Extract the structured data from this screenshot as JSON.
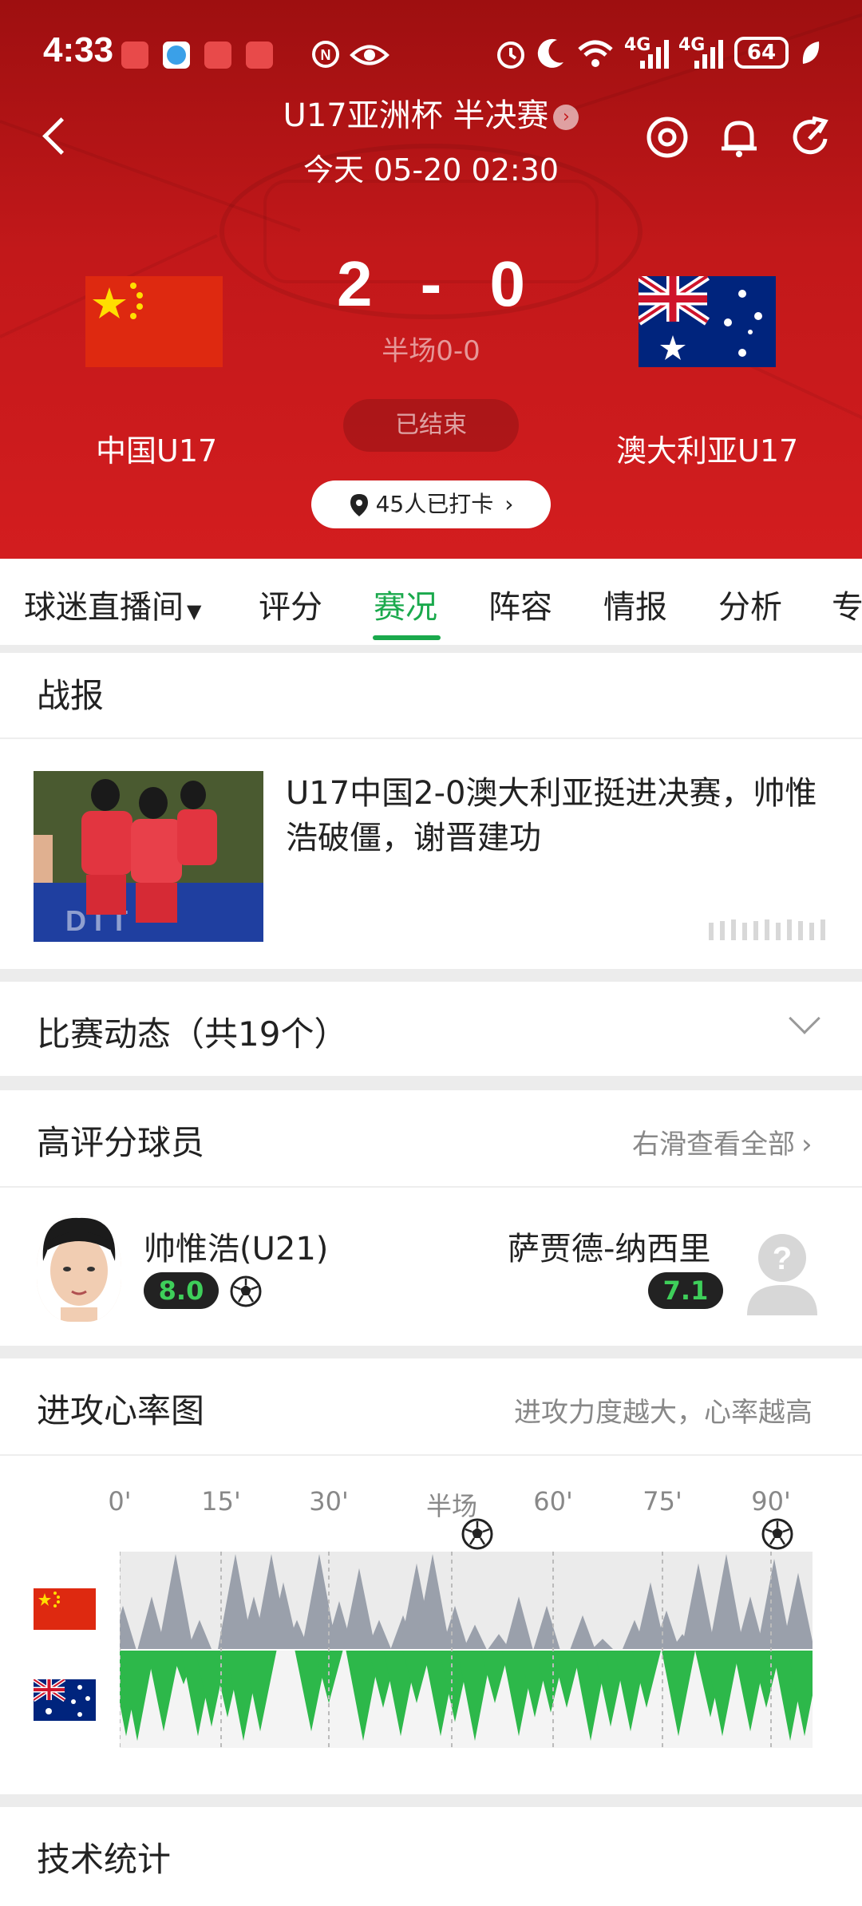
{
  "status_bar": {
    "time": "4:33",
    "battery": "64",
    "net1": "4G",
    "net2": "4G"
  },
  "header": {
    "competition": "U17亚洲杯 半决赛",
    "match_time": "今天 05-20 02:30",
    "home_team": "中国U17",
    "away_team": "澳大利亚U17",
    "home_score": "2",
    "score_sep": "-",
    "away_score": "0",
    "halftime": "半场0-0",
    "status": "已结束",
    "checkin": "45人已打卡"
  },
  "tabs": [
    "球迷直播间",
    "评分",
    "赛况",
    "阵容",
    "情报",
    "分析",
    "专"
  ],
  "active_tab": "赛况",
  "report": {
    "title": "战报",
    "headline": "U17中国2-0澳大利亚挺进决赛，帅惟浩破僵，谢晋建功"
  },
  "events": {
    "title": "比赛动态（共19个）"
  },
  "top_players": {
    "title": "高评分球员",
    "hint": "右滑查看全部",
    "players": [
      {
        "name": "帅惟浩(U21)",
        "rating": "8.0"
      },
      {
        "name": "萨贾德-纳西里",
        "rating": "7.1"
      }
    ]
  },
  "momentum": {
    "title": "进攻心率图",
    "hint": "进攻力度越大，心率越高",
    "axis_labels": [
      "0'",
      "15'",
      "30'",
      "半场",
      "60'",
      "75'",
      "90'"
    ]
  },
  "stats": {
    "title": "技术统计"
  },
  "colors": {
    "accent_green": "#1aa94c",
    "header_red": "#c2181a",
    "away_bar": "#2db84a",
    "home_bar": "#9aa0ab"
  }
}
